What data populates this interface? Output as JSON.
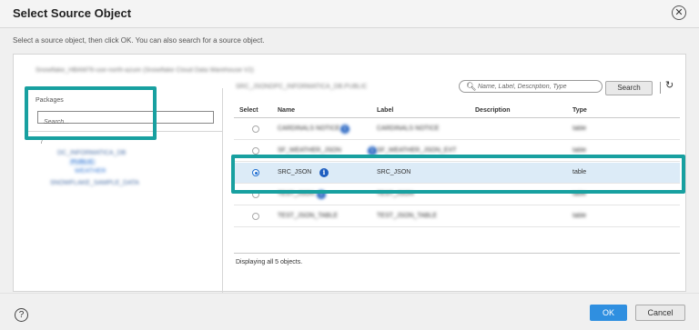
{
  "dialog": {
    "title": "Select Source Object",
    "close_glyph": "✕",
    "instructions": "Select a source object, then click OK. You can also search for a source object."
  },
  "connection": {
    "name": "Snowflake_HBAM76-use-north-azure (Snowflake Cloud Data Warehouse V2)",
    "schema": "SRC_JSONDPC_INFORMATICA_DB.PUBLIC"
  },
  "search": {
    "placeholder": "Name, Label, Description, Type",
    "button_label": "Search",
    "refresh_glyph": "↻"
  },
  "packages": {
    "label": "Packages",
    "search_placeholder": "Search...",
    "tree": [
      {
        "label": "/",
        "level": 0
      },
      {
        "label": "DC_INFORMATICA_DB",
        "level": 1
      },
      {
        "label": "PUBLIC",
        "level": 2,
        "selected": true
      },
      {
        "label": "WEATHER",
        "level": 3
      },
      {
        "label": "SNOWFLAKE_SAMPLE_DATA",
        "level": 1
      }
    ]
  },
  "table": {
    "columns": [
      "Select",
      "Name",
      "Label",
      "Description",
      "Type"
    ],
    "rows": [
      {
        "name": "CARDINALS NOTICE",
        "label": "CARDINALS NOTICE",
        "description": "",
        "type": "table",
        "has_info": true,
        "selected": false,
        "blurred": true
      },
      {
        "name": "SF_WEATHER_JSON",
        "label": "SF_WEATHER_JSON_EXT",
        "description": "",
        "type": "table",
        "has_info": true,
        "selected": false,
        "blurred": true
      },
      {
        "name": "SRC_JSON",
        "label": "SRC_JSON",
        "description": "",
        "type": "table",
        "has_info": true,
        "selected": true,
        "blurred": false
      },
      {
        "name": "TEST_JSON",
        "label": "TEST_JSON",
        "description": "",
        "type": "table",
        "has_info": true,
        "selected": false,
        "blurred": true
      },
      {
        "name": "TEST_JSON_TABLE",
        "label": "TEST_JSON_TABLE",
        "description": "",
        "type": "table",
        "has_info": false,
        "selected": false,
        "blurred": true
      }
    ],
    "status": "Displaying all 5 objects."
  },
  "footer": {
    "help_glyph": "?",
    "ok_label": "OK",
    "cancel_label": "Cancel"
  },
  "colors": {
    "highlight": "#18a0a0",
    "selected_row": "#dcebf7",
    "primary": "#2f8fe0",
    "info_icon": "#1f5fc0"
  }
}
